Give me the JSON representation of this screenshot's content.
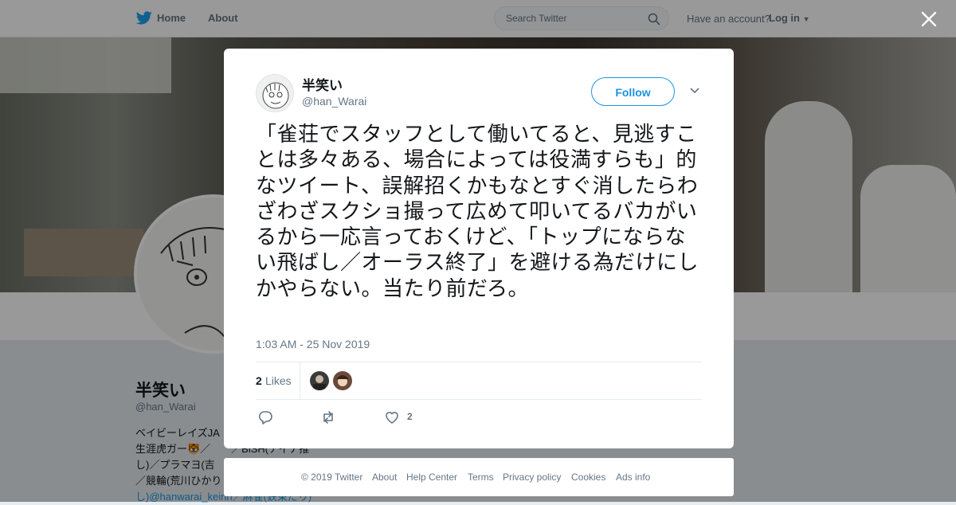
{
  "header": {
    "nav": [
      {
        "label": "Home"
      },
      {
        "label": "About"
      }
    ],
    "search_placeholder": "Search Twitter",
    "account_prompt": "Have an account?",
    "login_label": "Log in"
  },
  "profile": {
    "name": "半笑い",
    "handle": "@han_Warai",
    "bio_lines": [
      "ベイビーレイズJA",
      "生涯虎ガー🐯／　　／BiSH(アイナ推",
      "し)／プラマヨ(吉",
      "／競輪(荒川ひかり",
      "し)@hanwarai_keirin／麻雀(鉄束だり)"
    ]
  },
  "tweet": {
    "author_name": "半笑い",
    "author_handle": "@han_Warai",
    "follow_label": "Follow",
    "text": "「雀荘でスタッフとして働いてると、見逃すことは多々ある、場合によっては役満すらも」的なツイート、誤解招くかもなとすぐ消したらわざわざスクショ撮って広めて叩いてるバカがいるから一応言っておくけど、「トップにならない飛ばし／オーラス終了」を避ける為だけにしかやらない。当たり前だろ。",
    "timestamp": "1:03 AM - 25 Nov 2019",
    "likes_count": "2",
    "likes_label": "Likes",
    "action_like_count": "2"
  },
  "footer": {
    "links": [
      "© 2019 Twitter",
      "About",
      "Help Center",
      "Terms",
      "Privacy policy",
      "Cookies",
      "Ads info"
    ]
  },
  "colors": {
    "accent": "#1b95e0",
    "secondary_text": "#657786",
    "primary_text": "#14171a"
  },
  "icons": [
    "twitter-bird-icon",
    "search-icon",
    "caret-down-icon",
    "close-icon",
    "reply-icon",
    "retweet-icon",
    "heart-icon"
  ]
}
